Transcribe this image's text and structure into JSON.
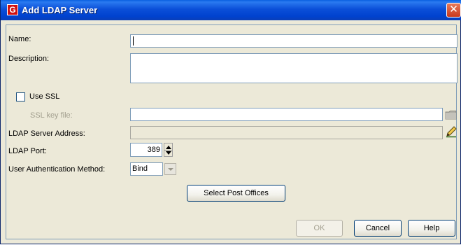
{
  "window": {
    "title": "Add LDAP Server",
    "app_icon_letter": "G",
    "close_glyph": "✕"
  },
  "form": {
    "name_label": "Name:",
    "name_value": "",
    "description_label": "Description:",
    "description_value": "",
    "use_ssl_label": "Use SSL",
    "use_ssl_checked": false,
    "ssl_key_file_label": "SSL key file:",
    "ssl_key_file_value": "",
    "ldap_server_address_label": "LDAP Server Address:",
    "ldap_server_address_value": "",
    "ldap_port_label": "LDAP Port:",
    "ldap_port_value": "389",
    "auth_method_label": "User Authentication Method:",
    "auth_method_value": "Bind",
    "select_post_offices_label": "Select Post Offices"
  },
  "buttons": {
    "ok_label": "OK",
    "cancel_label": "Cancel",
    "help_label": "Help"
  },
  "icons": {
    "browse": "folder-icon",
    "edit": "pencil-icon",
    "spinner": "spinner-arrows-icon",
    "dropdown": "chevron-down-icon"
  },
  "colors": {
    "titlebar": "#0042cf",
    "dialog_bg": "#ece9d8",
    "close_button": "#c8391d",
    "app_icon": "#d11010"
  }
}
